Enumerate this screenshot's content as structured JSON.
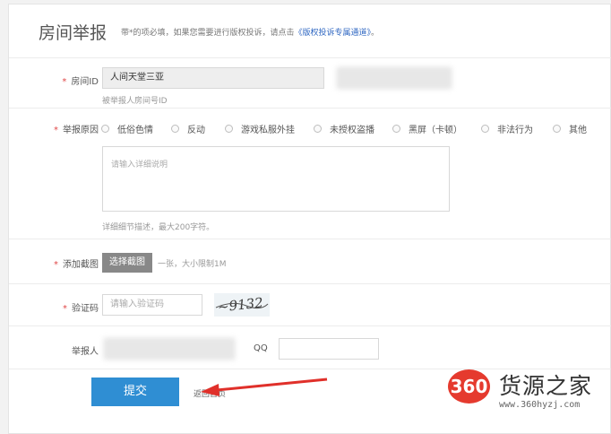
{
  "header": {
    "title": "房间举报",
    "hint_prefix": "带*的项必填，如果您需要进行版权投诉，请点击",
    "hint_link": "《版权投诉专属通道》",
    "hint_suffix": "。"
  },
  "required_mark": "*",
  "room": {
    "label": "房间ID",
    "value": "人间天堂三亚",
    "id_value": "",
    "hint": "被举报人房间号ID"
  },
  "reason": {
    "label": "举报原因",
    "options": [
      "低俗色情",
      "反动",
      "游戏私服外挂",
      "未授权盗播",
      "黑屏（卡顿）",
      "非法行为",
      "其他"
    ],
    "placeholder": "请输入详细说明",
    "hint": "详细细节描述，最大200字符。"
  },
  "screenshot": {
    "label": "添加截图",
    "button": "选择截图",
    "hint": "一张，大小限制1M"
  },
  "captcha": {
    "label": "验证码",
    "placeholder": "请输入验证码",
    "image_text": "~9132"
  },
  "reporter": {
    "label": "举报人",
    "value": "",
    "qq_label": "QQ",
    "qq_value": ""
  },
  "actions": {
    "submit": "提交",
    "back": "返回首页"
  },
  "watermark": {
    "logo": "360",
    "name": "货源之家",
    "url": "www.360hyzj.com"
  },
  "colors": {
    "accent": "#2f8ed3",
    "required": "#e04848",
    "link": "#2f67c2",
    "arrow": "#e0302a",
    "logo": "#e53a2e"
  }
}
